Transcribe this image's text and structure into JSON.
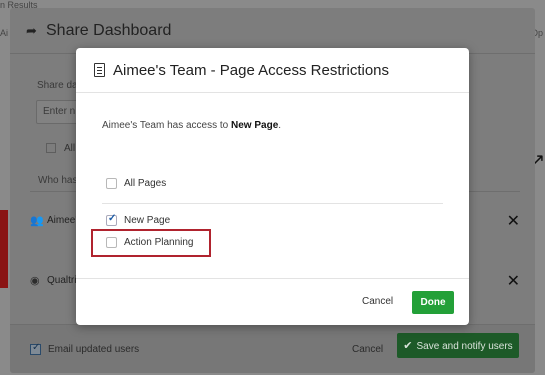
{
  "background": {
    "top_text": "n Results",
    "left_fragment": "Ai",
    "right_fragment": "Op"
  },
  "share_dialog": {
    "title": "Share Dashboard",
    "share_label": "Share das",
    "input_placeholder": "Enter n",
    "all_label": "All",
    "who_label": "Who has",
    "users": [
      {
        "name": "Aimee's"
      },
      {
        "name": "Qualtri"
      }
    ],
    "remove_glyph": "✕",
    "email_label": "Email updated users",
    "email_checked": true,
    "cancel_label": "Cancel",
    "save_label": "Save and notify users"
  },
  "access_dialog": {
    "title": "Aimee's Team - Page Access Restrictions",
    "desc_prefix": "Aimee's Team has access to ",
    "desc_page": "New Page",
    "desc_suffix": ".",
    "all_pages_label": "All Pages",
    "all_pages_checked": false,
    "pages": [
      {
        "label": "New Page",
        "checked": true
      },
      {
        "label": "Action Planning",
        "checked": false
      }
    ],
    "cancel_label": "Cancel",
    "done_label": "Done"
  },
  "colors": {
    "done_green": "#23a038",
    "highlight_red": "#b0232e",
    "check_blue": "#1a5aa6"
  }
}
